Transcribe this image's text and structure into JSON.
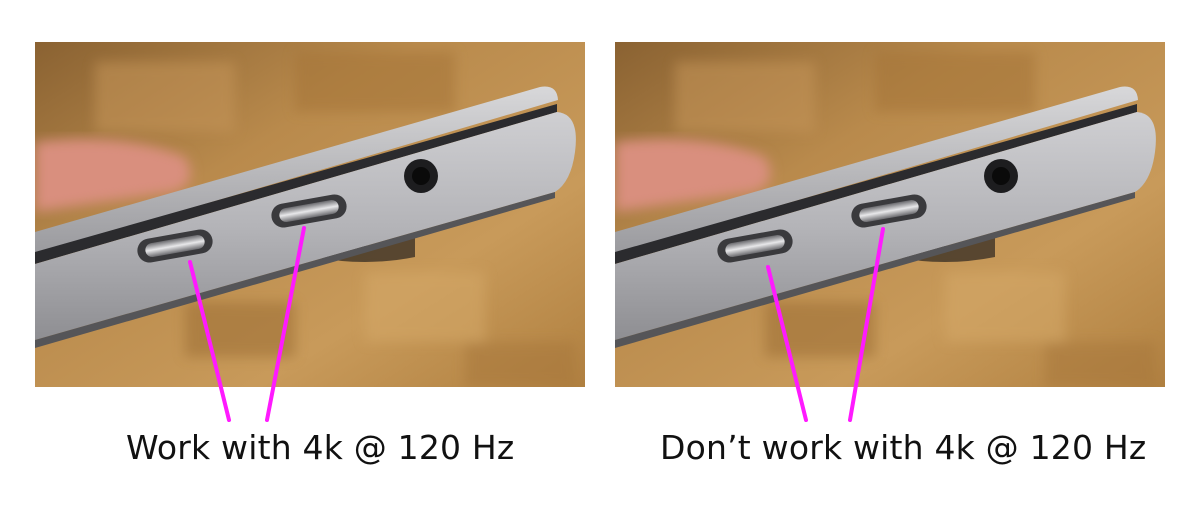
{
  "photos": [
    {
      "subject": "laptop-right-side",
      "ports": [
        "usb-c-port",
        "usb-c-port",
        "headphone-jack"
      ],
      "caption": "Work with 4k @ 120 Hz"
    },
    {
      "subject": "laptop-right-side",
      "ports": [
        "usb-c-port",
        "usb-c-port",
        "headphone-jack"
      ],
      "caption": "Don’t work with 4k @ 120 Hz"
    }
  ],
  "colors": {
    "pointer_line": "#ff1aff",
    "background_wood": "#b88848",
    "laptop_body": "#b8b8ba",
    "caption_text": "#111111"
  }
}
